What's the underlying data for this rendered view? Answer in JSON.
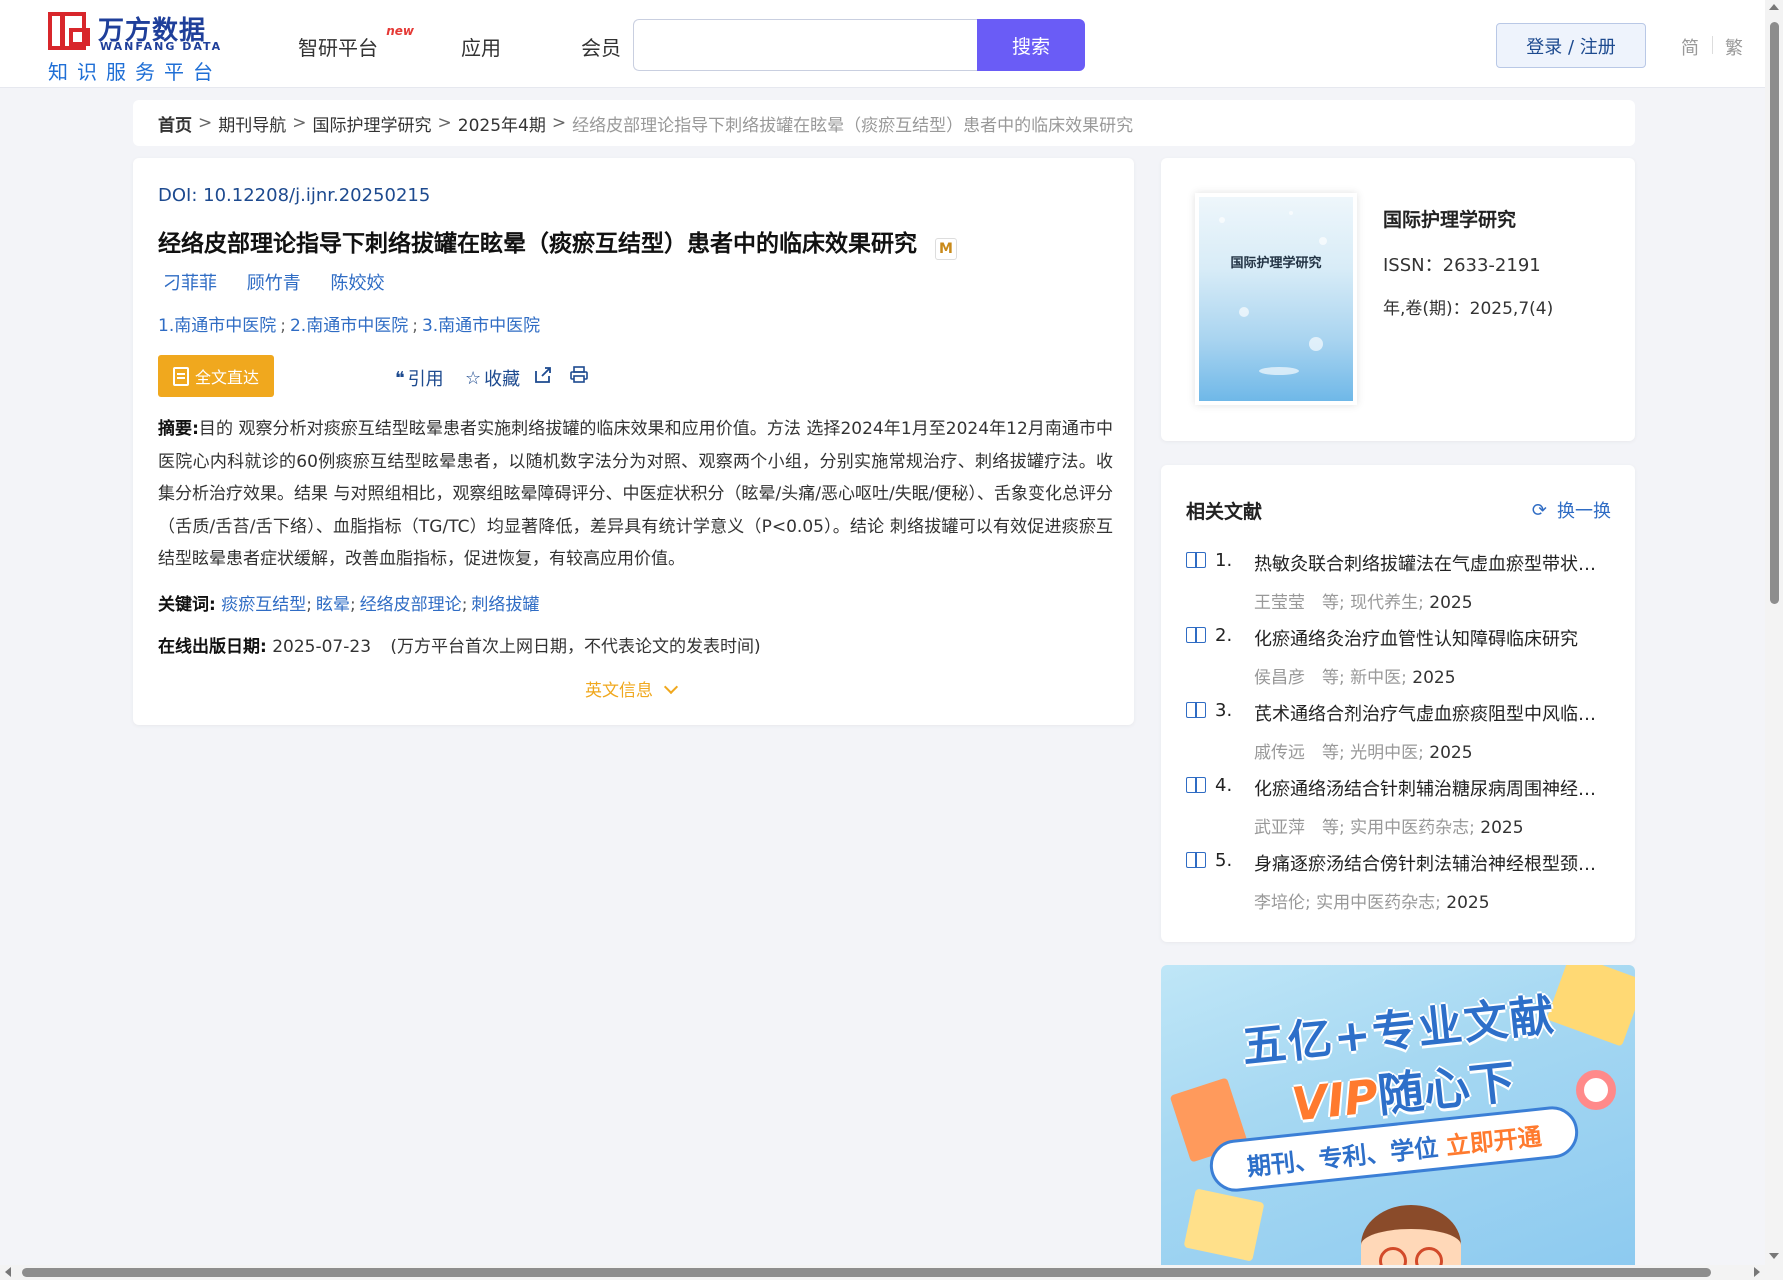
{
  "header": {
    "logo_cn": "万方数据",
    "logo_en": "WANFANG DATA",
    "logo_sub": "知识服务平台",
    "nav": [
      {
        "label": "智研平台",
        "badge": "new"
      },
      {
        "label": "应用"
      },
      {
        "label": "会员"
      }
    ],
    "search_value": "",
    "search_button": "搜索",
    "login_button": "登录 / 注册",
    "lang_simplified": "简",
    "lang_traditional": "繁"
  },
  "breadcrumb": {
    "home": "首页",
    "items": [
      "期刊导航",
      "国际护理学研究",
      "2025年4期"
    ],
    "current": "经络皮部理论指导下刺络拔罐在眩晕（痰瘀互结型）患者中的临床效果研究"
  },
  "article": {
    "doi_label": "DOI:",
    "doi": "10.12208/j.ijnr.20250215",
    "title": "经络皮部理论指导下刺络拔罐在眩晕（痰瘀互结型）患者中的临床效果研究",
    "title_badge": "M",
    "authors": [
      "刁菲菲",
      "顾竹青",
      "陈姣姣"
    ],
    "affiliations": [
      "1.南通市中医院",
      "2.南通市中医院",
      "3.南通市中医院"
    ],
    "affil_sep": ";",
    "full_text_button": "全文直达",
    "cite_label": "引用",
    "favorite_label": "收藏",
    "abstract_label": "摘要:",
    "abstract": "目的 观察分析对痰瘀互结型眩晕患者实施刺络拔罐的临床效果和应用价值。方法 选择2024年1月至2024年12月南通市中医院心内科就诊的60例痰瘀互结型眩晕患者，以随机数字法分为对照、观察两个小组，分别实施常规治疗、刺络拔罐疗法。收集分析治疗效果。结果 与对照组相比，观察组眩晕障碍评分、中医症状积分（眩晕/头痛/恶心呕吐/失眠/便秘）、舌象变化总评分（舌质/舌苔/舌下络）、血脂指标（TG/TC）均显著降低，差异具有统计学意义（P<0.05）。结论 刺络拔罐可以有效促进痰瘀互结型眩晕患者症状缓解，改善血脂指标，促进恢复，有较高应用价值。",
    "keywords_label": "关键词:",
    "keywords": [
      "痰瘀互结型",
      "眩晕",
      "经络皮部理论",
      "刺络拔罐"
    ],
    "keyword_sep": ";",
    "pubdate_label": "在线出版日期:",
    "pubdate": "2025-07-23",
    "pubdate_note": "(万方平台首次上网日期，不代表论文的发表时间)",
    "english_info": "英文信息"
  },
  "journal": {
    "name": "国际护理学研究",
    "cover_title": "国际护理学研究",
    "issn_label": "ISSN：",
    "issn": "2633-2191",
    "year_label": "年,卷(期)：",
    "year": "2025,7(4)"
  },
  "related": {
    "heading": "相关文献",
    "refresh": "换一换",
    "items": [
      {
        "num": "1.",
        "title": "热敏灸联合刺络拔罐法在气虚血瘀型带状疱疹后遗神经痛中的应用",
        "authors": "王莹莹　等;",
        "source": "现代养生",
        "year": "2025"
      },
      {
        "num": "2.",
        "title": "化瘀通络灸治疗血管性认知障碍临床研究",
        "authors": "侯昌彦　等;",
        "source": "新中医",
        "year": "2025"
      },
      {
        "num": "3.",
        "title": "芪术通络合剂治疗气虚血瘀痰阻型中风临床观察",
        "authors": "戚传远　等;",
        "source": "光明中医",
        "year": "2025"
      },
      {
        "num": "4.",
        "title": "化瘀通络汤结合针刺辅治糖尿病周围神经病变临床研究",
        "authors": "武亚萍　等;",
        "source": "实用中医药杂志",
        "year": "2025"
      },
      {
        "num": "5.",
        "title": "身痛逐瘀汤结合傍针刺法辅治神经根型颈椎病临床观察",
        "authors": "李培伦;",
        "source": "实用中医药杂志",
        "year": "2025"
      }
    ],
    "source_sep": ";"
  },
  "banner": {
    "line1": "五亿+专业文献",
    "line2_a": "VIP",
    "line2_b": "随心下",
    "line3_a": "期刊、专利、学位",
    "line3_b": "立即开通"
  }
}
